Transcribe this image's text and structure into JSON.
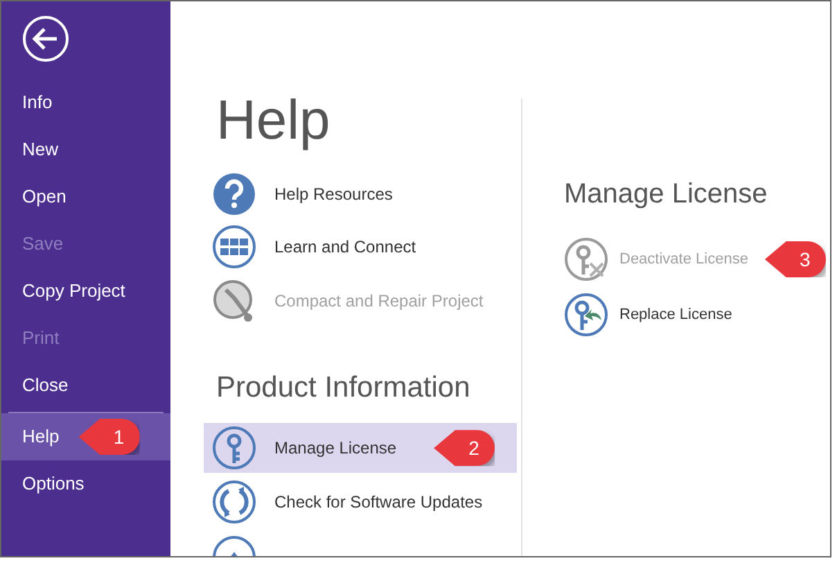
{
  "sidebar": {
    "items": [
      {
        "label": "Info",
        "selected": false,
        "disabled": false
      },
      {
        "label": "New",
        "selected": false,
        "disabled": false
      },
      {
        "label": "Open",
        "selected": false,
        "disabled": false
      },
      {
        "label": "Save",
        "selected": false,
        "disabled": true
      },
      {
        "label": "Copy Project",
        "selected": false,
        "disabled": false
      },
      {
        "label": "Print",
        "selected": false,
        "disabled": true
      },
      {
        "label": "Close",
        "selected": false,
        "disabled": false
      },
      {
        "label": "Help",
        "selected": true,
        "disabled": false,
        "callout": "1"
      },
      {
        "label": "Options",
        "selected": false,
        "disabled": false
      }
    ]
  },
  "help": {
    "title": "Help",
    "items": [
      {
        "label": "Help Resources",
        "disabled": false
      },
      {
        "label": "Learn and Connect",
        "disabled": false
      },
      {
        "label": "Compact and Repair Project",
        "disabled": true
      }
    ]
  },
  "product_information": {
    "title": "Product Information",
    "items": [
      {
        "label": "Manage License",
        "selected": true,
        "callout": "2"
      },
      {
        "label": "Check for Software Updates",
        "selected": false
      }
    ]
  },
  "manage_license": {
    "title": "Manage License",
    "items": [
      {
        "label": "Deactivate License",
        "disabled": true,
        "callout": "3"
      },
      {
        "label": "Replace License",
        "disabled": false
      }
    ]
  }
}
